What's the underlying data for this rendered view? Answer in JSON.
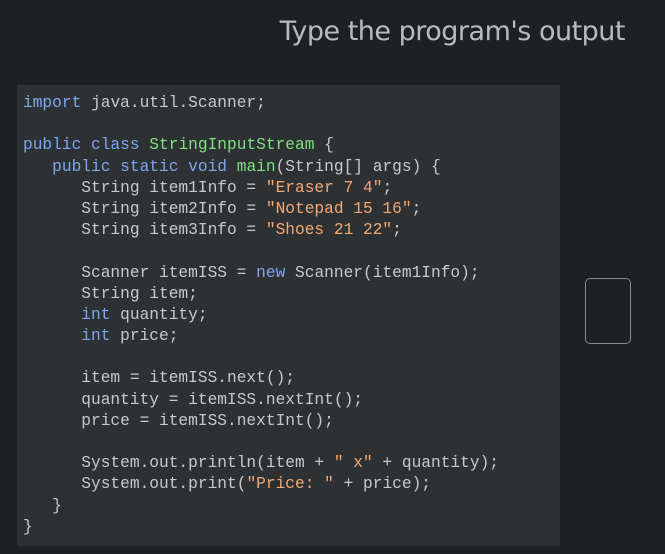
{
  "header": {
    "title": "Type the program's output"
  },
  "code": {
    "lines": [
      [
        [
          "kw",
          "import"
        ],
        [
          "plain",
          " java.util.Scanner;"
        ]
      ],
      [],
      [
        [
          "kw",
          "public class "
        ],
        [
          "cls",
          "StringInputStream"
        ],
        [
          "plain",
          " {"
        ]
      ],
      [
        [
          "plain",
          "   "
        ],
        [
          "kw",
          "public static void "
        ],
        [
          "cls",
          "main"
        ],
        [
          "plain",
          "(String[] args) {"
        ]
      ],
      [
        [
          "plain",
          "      String item1Info = "
        ],
        [
          "str",
          "\"Eraser 7 4\""
        ],
        [
          "plain",
          ";"
        ]
      ],
      [
        [
          "plain",
          "      String item2Info = "
        ],
        [
          "str",
          "\"Notepad 15 16\""
        ],
        [
          "plain",
          ";"
        ]
      ],
      [
        [
          "plain",
          "      String item3Info = "
        ],
        [
          "str",
          "\"Shoes 21 22\""
        ],
        [
          "plain",
          ";"
        ]
      ],
      [],
      [
        [
          "plain",
          "      Scanner itemISS = "
        ],
        [
          "kw",
          "new"
        ],
        [
          "plain",
          " Scanner(item1Info);"
        ]
      ],
      [
        [
          "plain",
          "      String item;"
        ]
      ],
      [
        [
          "plain",
          "      "
        ],
        [
          "kw",
          "int"
        ],
        [
          "plain",
          " quantity;"
        ]
      ],
      [
        [
          "plain",
          "      "
        ],
        [
          "kw",
          "int"
        ],
        [
          "plain",
          " price;"
        ]
      ],
      [],
      [
        [
          "plain",
          "      item = itemISS.next();"
        ]
      ],
      [
        [
          "plain",
          "      quantity = itemISS.nextInt();"
        ]
      ],
      [
        [
          "plain",
          "      price = itemISS.nextInt();"
        ]
      ],
      [],
      [
        [
          "plain",
          "      System.out.println(item + "
        ],
        [
          "str",
          "\" x\""
        ],
        [
          "plain",
          " + quantity);"
        ]
      ],
      [
        [
          "plain",
          "      System.out.print("
        ],
        [
          "str",
          "\"Price: \""
        ],
        [
          "plain",
          " + price);"
        ]
      ],
      [
        [
          "plain",
          "   }"
        ]
      ],
      [
        [
          "plain",
          "}"
        ]
      ]
    ]
  },
  "answer": {
    "value": ""
  }
}
